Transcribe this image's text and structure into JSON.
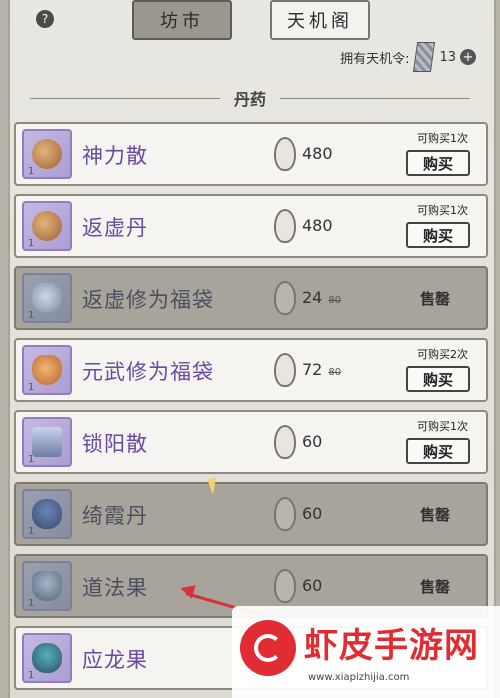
{
  "header": {
    "help_label": "?",
    "tabs": [
      {
        "label": "坊市",
        "active": true
      },
      {
        "label": "天机阁",
        "active": false
      }
    ],
    "token_label": "拥有天机令:",
    "token_count": "13",
    "plus_label": "+"
  },
  "section_title": "丹药",
  "items": [
    {
      "name": "神力散",
      "icon": "snail-icon",
      "count": "1",
      "price": "480",
      "old_price": "",
      "limit": "可购买1次",
      "action": "购买",
      "sold": false
    },
    {
      "name": "返虚丹",
      "icon": "snail-icon",
      "count": "1",
      "price": "480",
      "old_price": "",
      "limit": "可购买1次",
      "action": "购买",
      "sold": false
    },
    {
      "name": "返虚修为福袋",
      "icon": "bag-icon",
      "count": "1",
      "price": "24",
      "old_price": "80",
      "limit": "",
      "action": "售罄",
      "sold": true
    },
    {
      "name": "元武修为福袋",
      "icon": "bag-icon",
      "count": "1",
      "price": "72",
      "old_price": "80",
      "limit": "可购买2次",
      "action": "购买",
      "sold": false
    },
    {
      "name": "锁阳散",
      "icon": "chest-icon",
      "count": "1",
      "price": "60",
      "old_price": "",
      "limit": "可购买1次",
      "action": "购买",
      "sold": false
    },
    {
      "name": "绮霞丹",
      "icon": "lotus-icon",
      "count": "1",
      "price": "60",
      "old_price": "",
      "limit": "",
      "action": "售罄",
      "sold": true
    },
    {
      "name": "道法果",
      "icon": "fruit-icon",
      "count": "1",
      "price": "60",
      "old_price": "",
      "limit": "",
      "action": "售罄",
      "sold": true
    },
    {
      "name": "应龙果",
      "icon": "dragon-icon",
      "count": "1",
      "price": "",
      "old_price": "",
      "limit": "",
      "action": "",
      "sold": false
    }
  ],
  "watermark": {
    "title": "虾皮手游网",
    "url": "www.xiapizhijia.com"
  },
  "colors": {
    "panel_bg": "#e9e7e1",
    "sold_bg": "#a8a49c",
    "item_name": "#6a4aa1",
    "accent_red": "#e12c34"
  }
}
